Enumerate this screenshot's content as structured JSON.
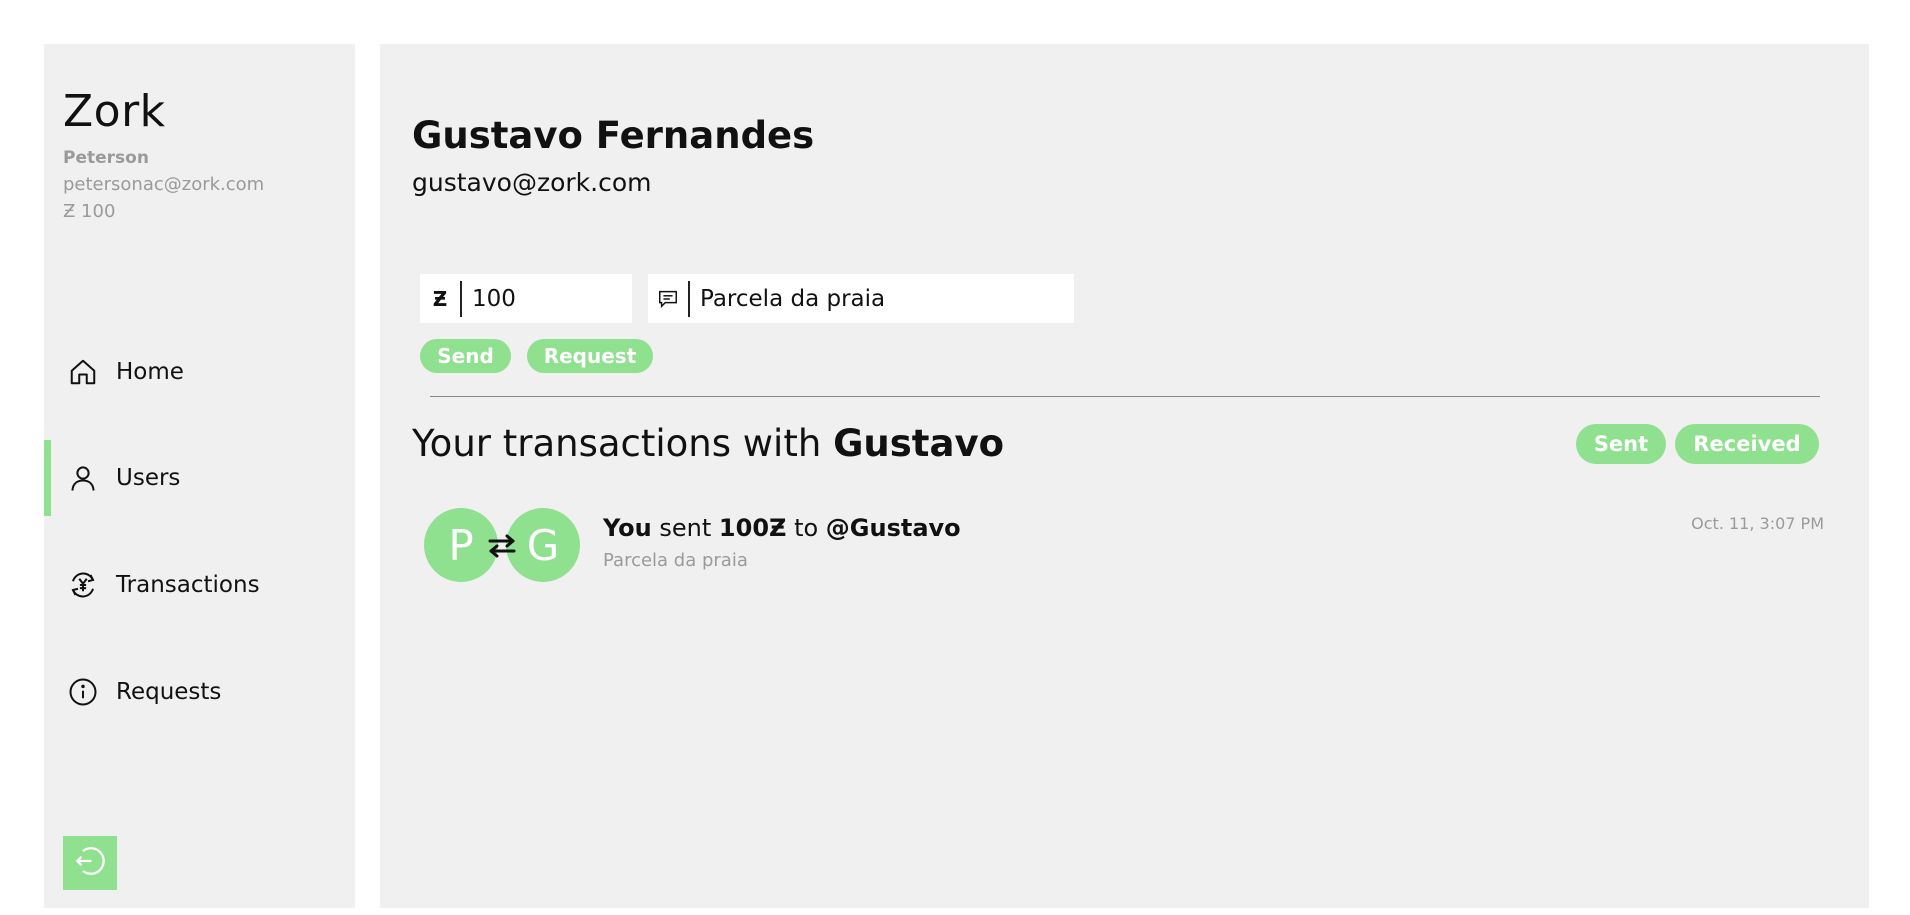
{
  "sidebar": {
    "brand": "Zork",
    "user": {
      "name": "Peterson",
      "email": "petersonac@zork.com",
      "balance": "Ƶ 100"
    },
    "nav": [
      {
        "label": "Home",
        "icon": "home-icon",
        "active": false
      },
      {
        "label": "Users",
        "icon": "user-icon",
        "active": true
      },
      {
        "label": "Transactions",
        "icon": "transactions-icon",
        "active": false
      },
      {
        "label": "Requests",
        "icon": "info-icon",
        "active": false
      }
    ],
    "logout_icon": "logout-icon"
  },
  "main": {
    "title": "Gustavo Fernandes",
    "email": "gustavo@zork.com",
    "form": {
      "currency_symbol": "Ƶ",
      "amount_value": "100",
      "note_value": "Parcela da praia",
      "note_icon": "message-icon",
      "send_label": "Send",
      "request_label": "Request"
    },
    "transactions": {
      "title_prefix": "Your transactions with",
      "title_name": "Gustavo",
      "filters": {
        "sent": "Sent",
        "received": "Received"
      },
      "items": [
        {
          "from_initial": "P",
          "to_initial": "G",
          "actor": "You",
          "verb": "sent",
          "amount": "100Ƶ",
          "preposition": "to",
          "target": "@Gustavo",
          "note": "Parcela da praia",
          "time": "Oct. 11, 3:07 PM"
        }
      ]
    }
  },
  "colors": {
    "accent": "#8fe08f",
    "panel": "#f0f0f0",
    "muted_text": "#9a9a9a"
  }
}
